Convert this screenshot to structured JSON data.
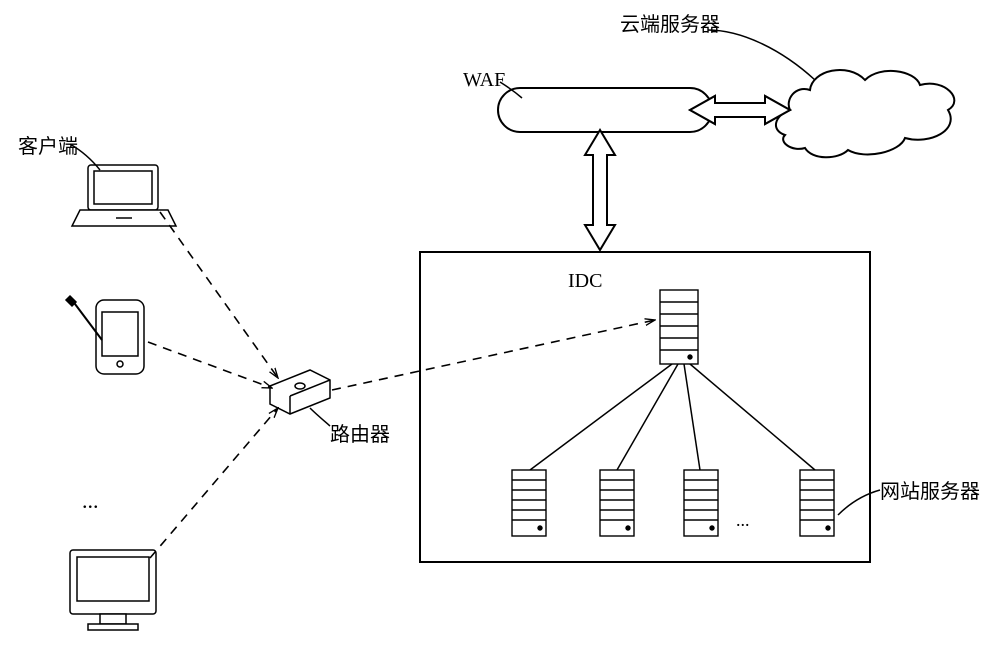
{
  "labels": {
    "cloud_server": "云端服务器",
    "waf": "WAF",
    "client": "客户端",
    "router": "路由器",
    "idc": "IDC",
    "web_server": "网站服务器",
    "ellipsis_clients": "...",
    "ellipsis_servers": "..."
  }
}
